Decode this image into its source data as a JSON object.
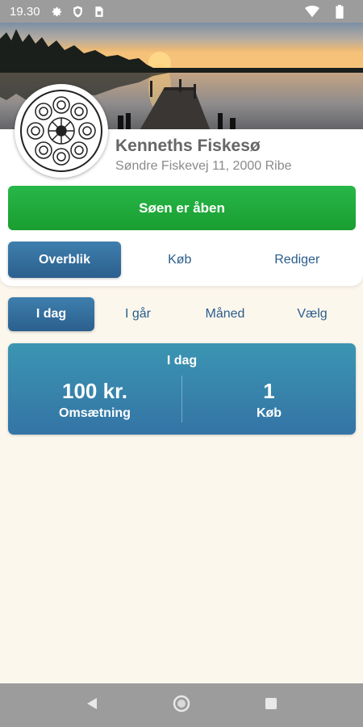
{
  "status_bar": {
    "time": "19.30",
    "icons": [
      "settings-gear-icon",
      "shield-icon",
      "sim-card-icon",
      "wifi-icon",
      "battery-icon"
    ]
  },
  "lake": {
    "name": "Kenneths Fiskesø",
    "address": "Søndre Fiskevej 11, 2000 Ribe",
    "status_button": "Søen er åben"
  },
  "tabs": [
    {
      "label": "Overblik",
      "active": true
    },
    {
      "label": "Køb",
      "active": false
    },
    {
      "label": "Rediger",
      "active": false
    }
  ],
  "periods": [
    {
      "label": "I dag",
      "active": true
    },
    {
      "label": "I går",
      "active": false
    },
    {
      "label": "Måned",
      "active": false
    },
    {
      "label": "Vælg",
      "active": false
    }
  ],
  "stats": {
    "title": "I dag",
    "revenue": {
      "value": "100 kr.",
      "label": "Omsætning"
    },
    "purchases": {
      "value": "1",
      "label": "Køb"
    }
  },
  "nav": [
    "back-icon",
    "home-icon",
    "recents-icon"
  ],
  "colors": {
    "accent_blue": "#2b5f8e",
    "open_green": "#1fa83a",
    "background": "#fcf7ed"
  }
}
